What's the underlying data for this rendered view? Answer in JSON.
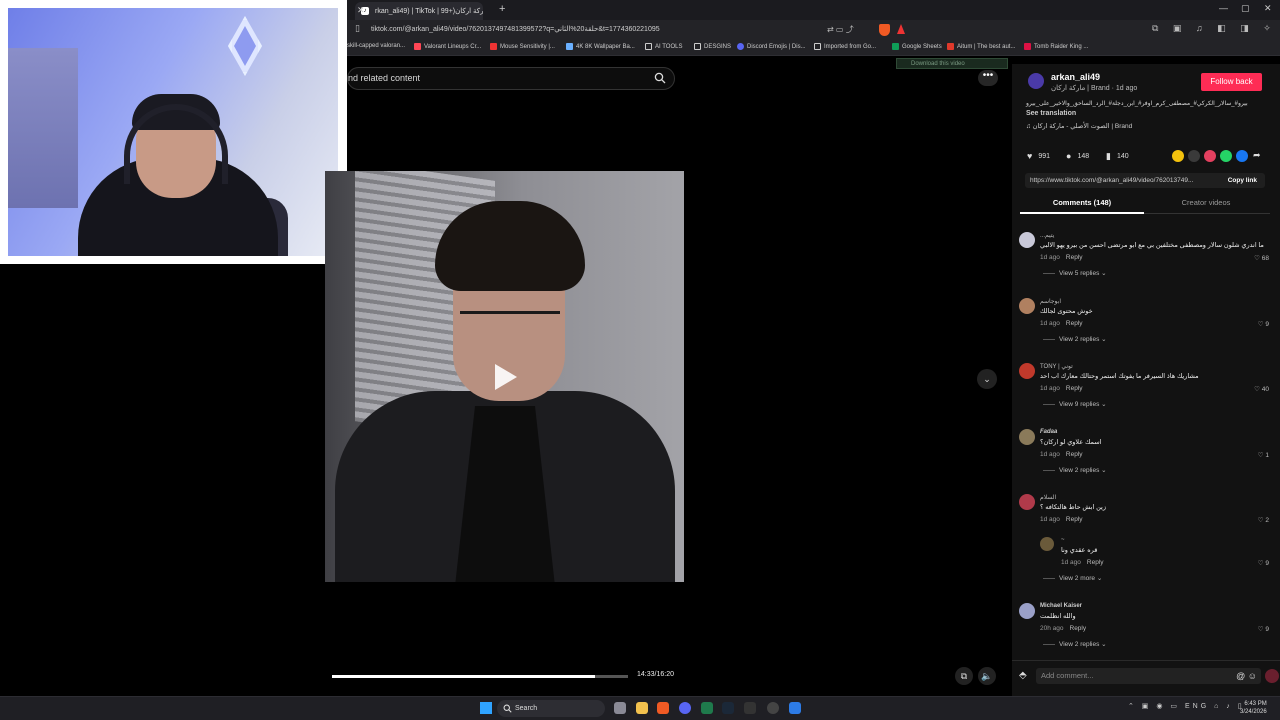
{
  "browser": {
    "tab_title": "rkan_ali49) | TikTok | مارکة ارکان(+99",
    "url": "tiktok.com/@arkan_ali49/video/7620137497481399572?q=حلقة20%الثاني&t=1774360221095",
    "bookmarks": [
      "skill-capped valoran...",
      "Valorant Lineups Cr...",
      "Mouse Sensitivity |...",
      "4K 8K Wallpaper Ba...",
      "AI TOOLS",
      "DESGINS",
      "Discord Emojis | Dis...",
      "Imported from Go...",
      "Google Sheets",
      "Aitum | The best aut...",
      "Tomb Raider King ..."
    ]
  },
  "player": {
    "search_text": "nd related content",
    "time": "14:33/16:20",
    "progress": 0.89,
    "download_chip": "Download this video"
  },
  "post": {
    "username": "arkan_ali49",
    "brand_line": "مارکة ارکان | Brand · 1d ago",
    "follow_label": "Follow back",
    "caption": "بيرو#_سالار_الكركي#_مصطفى_كرم_اوفر#_ابن_دجلة#_الرد_الساحق_والاخير_على_بيرو",
    "see_translation": "See translation",
    "music": "الصوت الأصلي - مارکة ارکان | Brand",
    "likes": "991",
    "comments_count": "148",
    "saves": "140",
    "link": "https://www.tiktok.com/@arkan_ali49/video/762013749...",
    "copy_link": "Copy link",
    "tab_comments": "Comments (148)",
    "tab_creator": "Creator videos",
    "share_colors": [
      "#f4c20d",
      "#3a3a3a",
      "#e4405f",
      "#25d366",
      "#1877f2"
    ]
  },
  "comments": [
    {
      "name": "...يتيم",
      "text": "ما اندري شلون سالار ومصطفى مختلفين بي مع ابو مرتضى احسن من بيرو يهو الالبي",
      "time": "1d ago",
      "reply": "Reply",
      "likes": "68",
      "replies": "View 5 replies",
      "color": "#c8c8d8"
    },
    {
      "name": "ابوجاسم",
      "text": "خوش محتوى لجالك",
      "time": "1d ago",
      "reply": "Reply",
      "likes": "9",
      "replies": "View 2 replies",
      "color": "#b08060"
    },
    {
      "name": "TONY | توني",
      "text": "مشاريك هاذ السيرفر ما يفوتك استمر وحتالك معارك اب احد",
      "time": "1d ago",
      "reply": "Reply",
      "likes": "40",
      "replies": "View 9 replies",
      "color": "#c0392b"
    },
    {
      "name": "Fadaa",
      "text": "اسمك علاوي لو اركان؟",
      "time": "1d ago",
      "reply": "Reply",
      "likes": "1",
      "replies": "View 2 replies",
      "color": "#8a7a5a"
    },
    {
      "name": "السلام",
      "text": "زين ابش حاط هالتكافه ؟",
      "time": "1d ago",
      "reply": "Reply",
      "likes": "2",
      "replies": "",
      "color": "#b03a4a"
    },
    {
      "name": "~",
      "text": "قره عقدي ونا",
      "time": "1d ago",
      "reply": "Reply",
      "likes": "9",
      "replies": "View 2 more",
      "color": "#6a5a3a"
    },
    {
      "name": "Michael Kaiser",
      "text": "والله انظلمت",
      "time": "20h ago",
      "reply": "Reply",
      "likes": "9",
      "replies": "View 2 replies",
      "color": "#9aa0c8"
    }
  ],
  "add_comment_placeholder": "Add comment...",
  "taskbar": {
    "search_label": "Search",
    "lang": "ENG",
    "time": "6:43 PM",
    "date": "3/24/2026"
  }
}
